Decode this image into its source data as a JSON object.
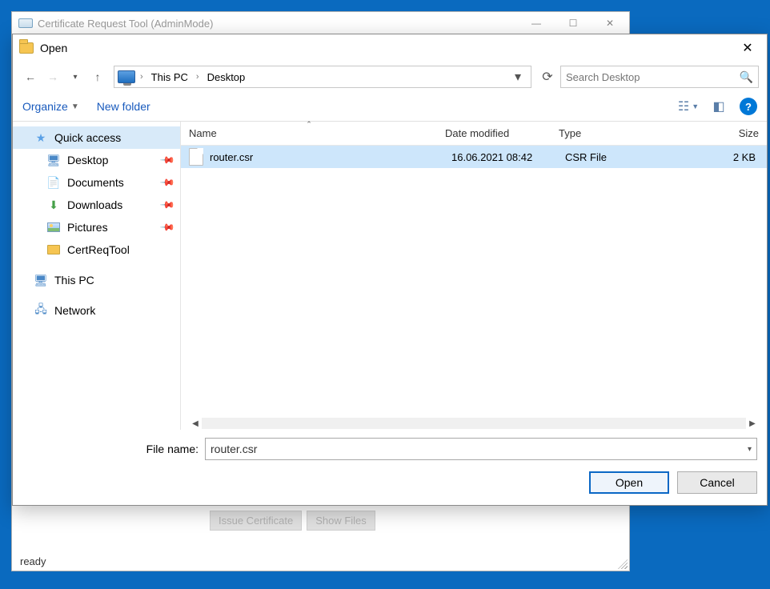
{
  "parent_window": {
    "title": "Certificate Request Tool (AdminMode)",
    "buttons": {
      "issue": "Issue Certificate",
      "show": "Show Files"
    },
    "status": "ready"
  },
  "dialog": {
    "title": "Open",
    "nav": {
      "breadcrumb": [
        "This PC",
        "Desktop"
      ]
    },
    "search_placeholder": "Search Desktop",
    "toolbar": {
      "organize": "Organize",
      "newfolder": "New folder"
    },
    "sidebar": {
      "quick_access": "Quick access",
      "desktop": "Desktop",
      "documents": "Documents",
      "downloads": "Downloads",
      "pictures": "Pictures",
      "certreqtool": "CertReqTool",
      "thispc": "This PC",
      "network": "Network"
    },
    "columns": {
      "name": "Name",
      "date": "Date modified",
      "type": "Type",
      "size": "Size"
    },
    "files": [
      {
        "name": "router.csr",
        "date": "16.06.2021 08:42",
        "type": "CSR File",
        "size": "2 KB",
        "selected": true
      }
    ],
    "filename_label": "File name:",
    "filename_value": "router.csr",
    "buttons": {
      "open": "Open",
      "cancel": "Cancel"
    }
  }
}
